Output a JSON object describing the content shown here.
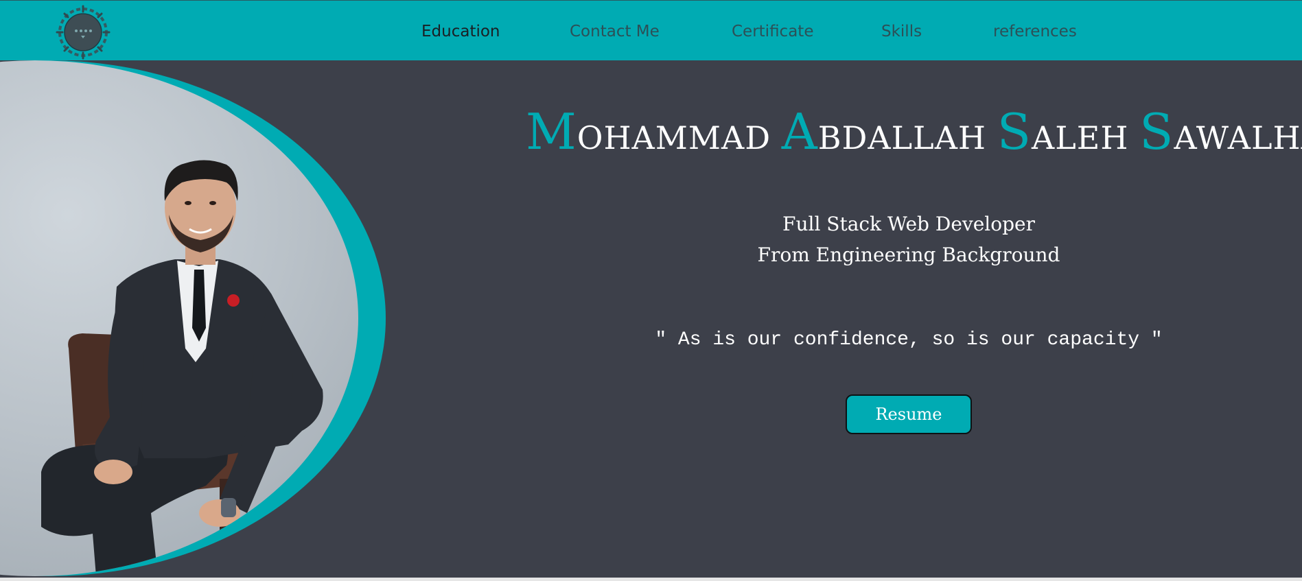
{
  "nav": {
    "items": [
      {
        "label": "Education",
        "active": true
      },
      {
        "label": "Contact Me",
        "active": false
      },
      {
        "label": "Certificate",
        "active": false
      },
      {
        "label": "Skills",
        "active": false
      },
      {
        "label": "references",
        "active": false
      }
    ]
  },
  "hero": {
    "name": [
      {
        "initial": "M",
        "rest": "OHAMMAD"
      },
      {
        "initial": "A",
        "rest": "BDALLAH"
      },
      {
        "initial": "S",
        "rest": "ALEH"
      },
      {
        "initial": "S",
        "rest": "AWALHA"
      }
    ],
    "title_line1": "Full Stack Web Developer",
    "title_line2": "From Engineering Background",
    "quote": "\" As is our confidence, so is our capacity \"",
    "resume_label": "Resume"
  },
  "colors": {
    "accent": "#00abb3",
    "background": "#3d404a",
    "text": "#ffffff",
    "nav_text": "#2c5057"
  },
  "icons": {
    "logo": "logo-gear-icon"
  }
}
